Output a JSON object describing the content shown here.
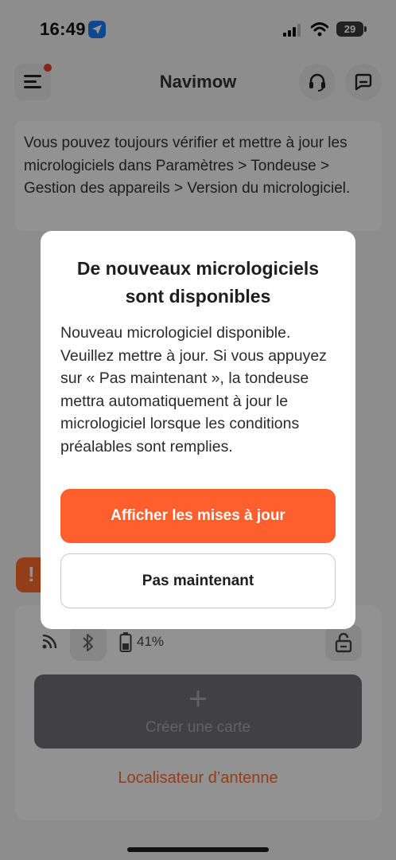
{
  "status_bar": {
    "time": "16:49",
    "battery": "29"
  },
  "header": {
    "title": "Navimow"
  },
  "info_card": {
    "text": "Vous pouvez toujours vérifier et mettre à jour les micrologiciels dans Paramètres > Tondeuse > Gestion des appareils > Version du micrologiciel."
  },
  "alert": {
    "symbol": "!"
  },
  "device": {
    "battery_percent": "41%",
    "create_map_icon": "+",
    "create_map_label": "Créer une carte",
    "antenna_link": "Localisateur d’antenne"
  },
  "dialog": {
    "title": "De nouveaux micrologiciels sont disponibles",
    "body": "Nouveau micrologiciel disponible. Veuillez mettre à jour. Si vous appuyez sur « Pas maintenant », la tondeuse mettra automatiquement à jour le micrologiciel lorsque les conditions préalables sont remplies.",
    "primary_button": "Afficher les mises à jour",
    "secondary_button": "Pas maintenant"
  },
  "colors": {
    "accent": "#ff5f2c",
    "location_badge": "#1a7cf5",
    "notification_dot": "#e8442c"
  },
  "icons": [
    "location-arrow-icon",
    "cellular-signal-icon",
    "wifi-icon",
    "battery-icon",
    "menu-icon",
    "headset-icon",
    "chat-icon",
    "rss-signal-icon",
    "bluetooth-icon",
    "mower-battery-icon",
    "unlock-icon",
    "alert-icon",
    "plus-icon"
  ]
}
